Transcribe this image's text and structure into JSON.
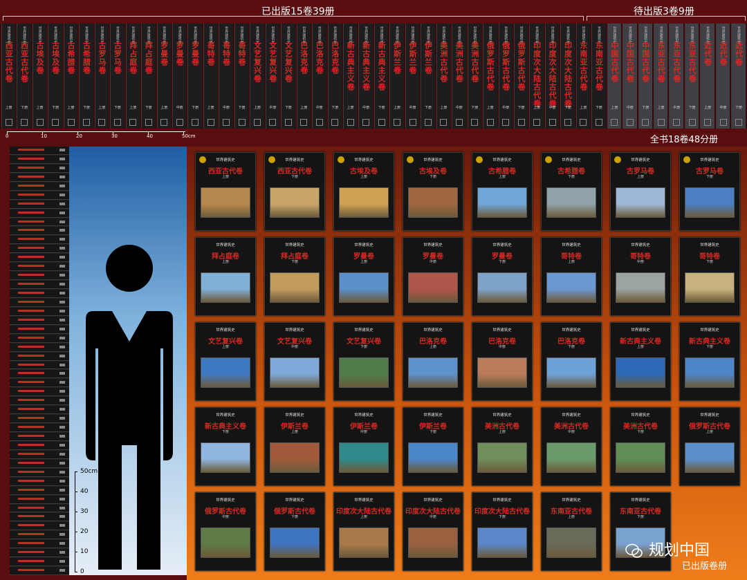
{
  "header": {
    "published_label": "已出版15卷39册",
    "pending_label": "待出版3卷9册"
  },
  "total_label": "全书18卷48分册",
  "ruler": {
    "labels": [
      "0",
      "10",
      "20",
      "30",
      "40",
      "50cm"
    ]
  },
  "height_scale": {
    "labels": [
      "50cm",
      "40",
      "30",
      "20",
      "10",
      "0"
    ]
  },
  "watermark": {
    "brand": "规划中国",
    "caption": "已出版卷册"
  },
  "series_name": "世界建筑史",
  "spines": [
    {
      "title": "西亚古代卷",
      "vol": "上册"
    },
    {
      "title": "西亚古代卷",
      "vol": "下册"
    },
    {
      "title": "古埃及卷",
      "vol": "上册"
    },
    {
      "title": "古埃及卷",
      "vol": "下册"
    },
    {
      "title": "古希腊卷",
      "vol": "上册"
    },
    {
      "title": "古希腊卷",
      "vol": "下册"
    },
    {
      "title": "古罗马卷",
      "vol": "上册"
    },
    {
      "title": "古罗马卷",
      "vol": "下册"
    },
    {
      "title": "拜占庭卷",
      "vol": "上册"
    },
    {
      "title": "拜占庭卷",
      "vol": "下册"
    },
    {
      "title": "罗曼卷",
      "vol": "上册"
    },
    {
      "title": "罗曼卷",
      "vol": "中册"
    },
    {
      "title": "罗曼卷",
      "vol": "下册"
    },
    {
      "title": "哥特卷",
      "vol": "上册"
    },
    {
      "title": "哥特卷",
      "vol": "中册"
    },
    {
      "title": "哥特卷",
      "vol": "下册"
    },
    {
      "title": "文艺复兴卷",
      "vol": "上册"
    },
    {
      "title": "文艺复兴卷",
      "vol": "中册"
    },
    {
      "title": "文艺复兴卷",
      "vol": "下册"
    },
    {
      "title": "巴洛克卷",
      "vol": "上册"
    },
    {
      "title": "巴洛克卷",
      "vol": "中册"
    },
    {
      "title": "巴洛克卷",
      "vol": "下册"
    },
    {
      "title": "新古典主义卷",
      "vol": "上册"
    },
    {
      "title": "新古典主义卷",
      "vol": "中册"
    },
    {
      "title": "新古典主义卷",
      "vol": "下册"
    },
    {
      "title": "伊斯兰卷",
      "vol": "上册"
    },
    {
      "title": "伊斯兰卷",
      "vol": "中册"
    },
    {
      "title": "伊斯兰卷",
      "vol": "下册"
    },
    {
      "title": "美洲古代卷",
      "vol": "上册"
    },
    {
      "title": "美洲古代卷",
      "vol": "中册"
    },
    {
      "title": "美洲古代卷",
      "vol": "下册"
    },
    {
      "title": "俄罗斯古代卷",
      "vol": "上册"
    },
    {
      "title": "俄罗斯古代卷",
      "vol": "中册"
    },
    {
      "title": "俄罗斯古代卷",
      "vol": "下册"
    },
    {
      "title": "印度次大陆古代卷",
      "vol": "上册"
    },
    {
      "title": "印度次大陆古代卷",
      "vol": "中册"
    },
    {
      "title": "印度次大陆古代卷",
      "vol": "下册"
    },
    {
      "title": "东南亚古代卷",
      "vol": "上册"
    },
    {
      "title": "东南亚古代卷",
      "vol": "下册"
    },
    {
      "title": "中国古代卷",
      "vol": "上册",
      "pending": true
    },
    {
      "title": "中国古代卷",
      "vol": "中册",
      "pending": true
    },
    {
      "title": "中国古代卷",
      "vol": "下册",
      "pending": true
    },
    {
      "title": "东亚古代卷",
      "vol": "上册",
      "pending": true
    },
    {
      "title": "东亚古代卷",
      "vol": "中册",
      "pending": true
    },
    {
      "title": "东亚古代卷",
      "vol": "下册",
      "pending": true
    },
    {
      "title": "近代卷",
      "vol": "上册",
      "pending": true
    },
    {
      "title": "近代卷",
      "vol": "中册",
      "pending": true
    },
    {
      "title": "近代卷",
      "vol": "下册",
      "pending": true
    }
  ],
  "covers": [
    {
      "title": "西亚古代卷",
      "vol": "上册",
      "color": "#b7884d"
    },
    {
      "title": "西亚古代卷",
      "vol": "下册",
      "color": "#c9a46a"
    },
    {
      "title": "古埃及卷",
      "vol": "上册",
      "color": "#d0a252"
    },
    {
      "title": "古埃及卷",
      "vol": "下册",
      "color": "#a06840"
    },
    {
      "title": "古希腊卷",
      "vol": "上册",
      "color": "#6fa8d8"
    },
    {
      "title": "古希腊卷",
      "vol": "下册",
      "color": "#8fa3a8"
    },
    {
      "title": "古罗马卷",
      "vol": "上册",
      "color": "#9db9d7"
    },
    {
      "title": "古罗马卷",
      "vol": "下册",
      "color": "#4b7fc1"
    },
    {
      "title": "拜占庭卷",
      "vol": "上册",
      "color": "#7fb0d8"
    },
    {
      "title": "拜占庭卷",
      "vol": "下册",
      "color": "#c29b5c"
    },
    {
      "title": "罗曼卷",
      "vol": "上册",
      "color": "#5b8fc9"
    },
    {
      "title": "罗曼卷",
      "vol": "中册",
      "color": "#b0554a"
    },
    {
      "title": "罗曼卷",
      "vol": "下册",
      "color": "#7da3c9"
    },
    {
      "title": "哥特卷",
      "vol": "上册",
      "color": "#6a98cf"
    },
    {
      "title": "哥特卷",
      "vol": "中册",
      "color": "#9aa4a0"
    },
    {
      "title": "哥特卷",
      "vol": "下册",
      "color": "#c7b27d"
    },
    {
      "title": "文艺复兴卷",
      "vol": "上册",
      "color": "#3e7ac4"
    },
    {
      "title": "文艺复兴卷",
      "vol": "中册",
      "color": "#7ea9d8"
    },
    {
      "title": "文艺复兴卷",
      "vol": "下册",
      "color": "#4f7d4a"
    },
    {
      "title": "巴洛克卷",
      "vol": "上册",
      "color": "#5d92cd"
    },
    {
      "title": "巴洛克卷",
      "vol": "中册",
      "color": "#b97b5a"
    },
    {
      "title": "巴洛克卷",
      "vol": "下册",
      "color": "#6da2d6"
    },
    {
      "title": "新古典主义卷",
      "vol": "上册",
      "color": "#2c69b8"
    },
    {
      "title": "新古典主义卷",
      "vol": "下册",
      "color": "#4d85c8"
    },
    {
      "title": "新古典主义卷",
      "vol": "下册",
      "color": "#8fb6df"
    },
    {
      "title": "伊斯兰卷",
      "vol": "上册",
      "color": "#a05a3a"
    },
    {
      "title": "伊斯兰卷",
      "vol": "中册",
      "color": "#2f8a8a"
    },
    {
      "title": "伊斯兰卷",
      "vol": "下册",
      "color": "#4a86c8"
    },
    {
      "title": "美洲古代卷",
      "vol": "上册",
      "color": "#6f8e5a"
    },
    {
      "title": "美洲古代卷",
      "vol": "中册",
      "color": "#6a9a6a"
    },
    {
      "title": "美洲古代卷",
      "vol": "下册",
      "color": "#5f8f55"
    },
    {
      "title": "俄罗斯古代卷",
      "vol": "上册",
      "color": "#5a8fc9"
    },
    {
      "title": "俄罗斯古代卷",
      "vol": "中册",
      "color": "#5e7a45"
    },
    {
      "title": "俄罗斯古代卷",
      "vol": "下册",
      "color": "#3f74c0"
    },
    {
      "title": "印度次大陆古代卷",
      "vol": "上册",
      "color": "#a87a4a"
    },
    {
      "title": "印度次大陆古代卷",
      "vol": "中册",
      "color": "#9a6040"
    },
    {
      "title": "印度次大陆古代卷",
      "vol": "下册",
      "color": "#5a88c8"
    },
    {
      "title": "东南亚古代卷",
      "vol": "上册",
      "color": "#6a6a5a"
    },
    {
      "title": "东南亚古代卷",
      "vol": "下册",
      "color": "#7aa2d0"
    }
  ]
}
